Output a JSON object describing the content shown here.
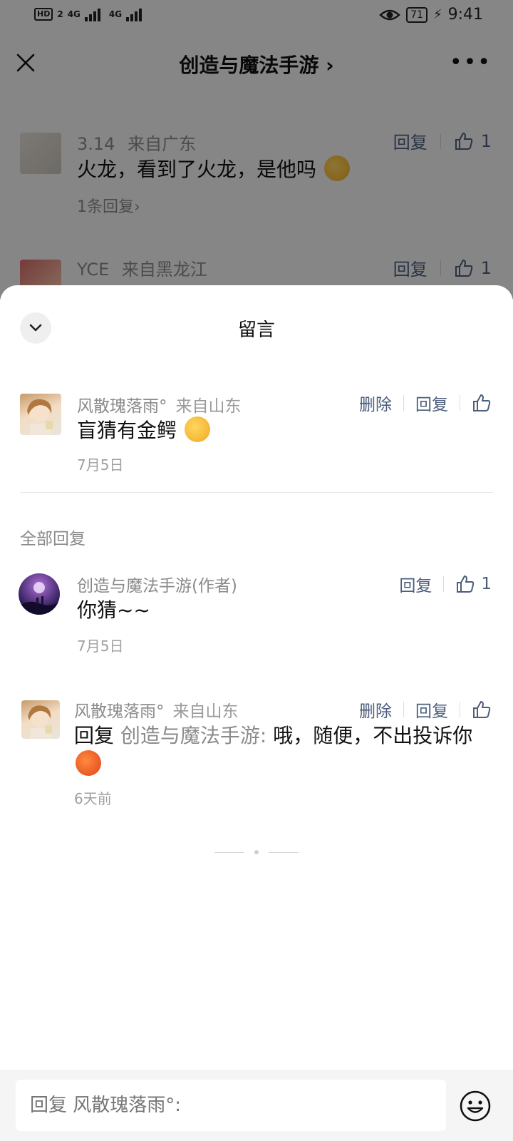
{
  "status_bar": {
    "hd": "HD",
    "sim": "2",
    "net1": "4G",
    "net2": "4G",
    "battery": "71",
    "time": "9:41"
  },
  "nav": {
    "title": "创造与魔法手游 ›",
    "more": "•••"
  },
  "background_comments": [
    {
      "name": "3.14",
      "location": "来自广东",
      "text": "火龙，看到了火龙，是他吗",
      "replies": "1条回复›",
      "reply_label": "回复",
      "likes": "1"
    },
    {
      "name": "YCE",
      "location": "来自黑龙江",
      "reply_label": "回复",
      "likes": "1"
    }
  ],
  "sheet": {
    "title": "留言",
    "main_comment": {
      "name": "风散瑰落雨°",
      "location": "来自山东",
      "text": "盲猜有金鳄",
      "date": "7月5日",
      "delete_label": "删除",
      "reply_label": "回复"
    },
    "all_replies_label": "全部回复",
    "replies": [
      {
        "name": "创造与魔法手游(作者)",
        "text": "你猜~~",
        "date": "7月5日",
        "reply_label": "回复",
        "likes": "1"
      },
      {
        "name": "风散瑰落雨°",
        "location": "来自山东",
        "reply_prefix": "回复",
        "mention": "创造与魔法手游:",
        "text": "哦，随便，不出投诉你",
        "date": "6天前",
        "delete_label": "删除",
        "reply_label": "回复"
      }
    ]
  },
  "input": {
    "placeholder": "回复 风散瑰落雨°:"
  }
}
